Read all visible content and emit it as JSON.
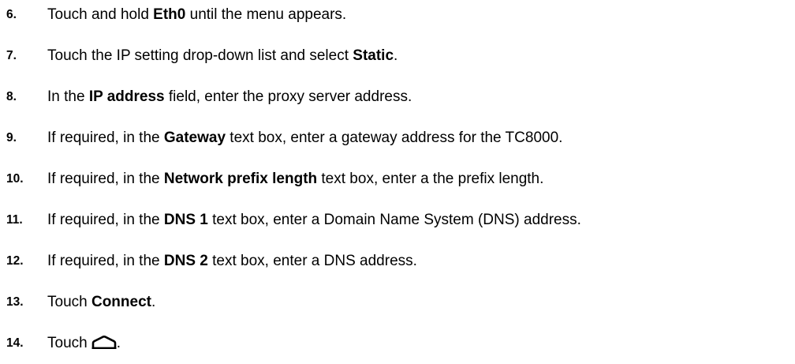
{
  "steps": [
    {
      "num": "6.",
      "parts": [
        "Touch and hold ",
        "Eth0",
        " until the menu appears."
      ]
    },
    {
      "num": "7.",
      "parts": [
        "Touch the IP setting drop-down list and select ",
        "Static",
        "."
      ]
    },
    {
      "num": "8.",
      "parts": [
        "In the ",
        "IP address",
        " field, enter the proxy server address."
      ]
    },
    {
      "num": "9.",
      "parts": [
        "If required, in the ",
        "Gateway",
        " text box, enter a gateway address for the TC8000."
      ]
    },
    {
      "num": "10.",
      "parts": [
        "If required, in the ",
        "Network prefix length",
        " text box, enter a the prefix length."
      ]
    },
    {
      "num": "11.",
      "parts": [
        "If required, in the ",
        "DNS 1",
        " text box, enter a Domain Name System (DNS) address."
      ]
    },
    {
      "num": "12.",
      "parts": [
        "If required, in the ",
        "DNS 2",
        " text box, enter a DNS address."
      ]
    },
    {
      "num": "13.",
      "parts": [
        "Touch ",
        "Connect",
        "."
      ]
    },
    {
      "num": "14.",
      "parts": [
        "Touch",
        "."
      ],
      "icon": "home-icon"
    }
  ]
}
